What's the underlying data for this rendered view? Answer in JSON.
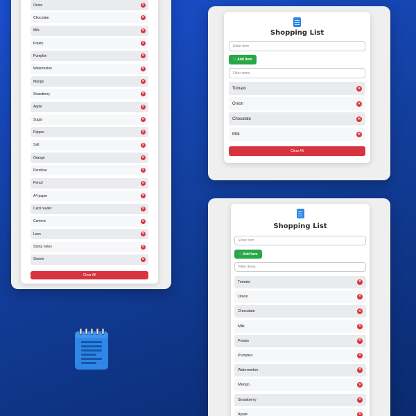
{
  "app": {
    "title": "Shopping List",
    "item_placeholder": "Enter item",
    "add_label": "Add Item",
    "filter_placeholder": "Filter items",
    "clear_label": "Clear All",
    "delete_symbol": "×",
    "add_icon": "cart-icon",
    "header_icon": "notepad-icon"
  },
  "colors": {
    "accent_blue": "#2f86e6",
    "add_green": "#28a745",
    "clear_red": "#d7343f",
    "background": "#1b4fd0"
  },
  "left_panel": {
    "items": [
      {
        "name": "Onion"
      },
      {
        "name": "Chocolate"
      },
      {
        "name": "Milk"
      },
      {
        "name": "Potato"
      },
      {
        "name": "Pumpkin"
      },
      {
        "name": "Watermelon"
      },
      {
        "name": "Mango"
      },
      {
        "name": "Strawberry"
      },
      {
        "name": "Apple"
      },
      {
        "name": "Sugar"
      },
      {
        "name": "Pepper"
      },
      {
        "name": "Salt"
      },
      {
        "name": "Orange"
      },
      {
        "name": "Pendrive"
      },
      {
        "name": "Pencil"
      },
      {
        "name": "A4 paper"
      },
      {
        "name": "Card reader"
      },
      {
        "name": "Camera"
      },
      {
        "name": "Lens"
      },
      {
        "name": "Sticky notes"
      },
      {
        "name": "Sketch"
      }
    ]
  },
  "top_right": {
    "items": [
      {
        "name": "Tomato"
      },
      {
        "name": "Onion"
      },
      {
        "name": "Chocolate"
      },
      {
        "name": "Milk"
      }
    ]
  },
  "bottom_right": {
    "items": [
      {
        "name": "Tomato"
      },
      {
        "name": "Onion"
      },
      {
        "name": "Chocolate"
      },
      {
        "name": "Milk"
      },
      {
        "name": "Potato"
      },
      {
        "name": "Pumpkin"
      },
      {
        "name": "Watermelon"
      },
      {
        "name": "Mango"
      },
      {
        "name": "Strawberry"
      },
      {
        "name": "Apple"
      }
    ]
  }
}
